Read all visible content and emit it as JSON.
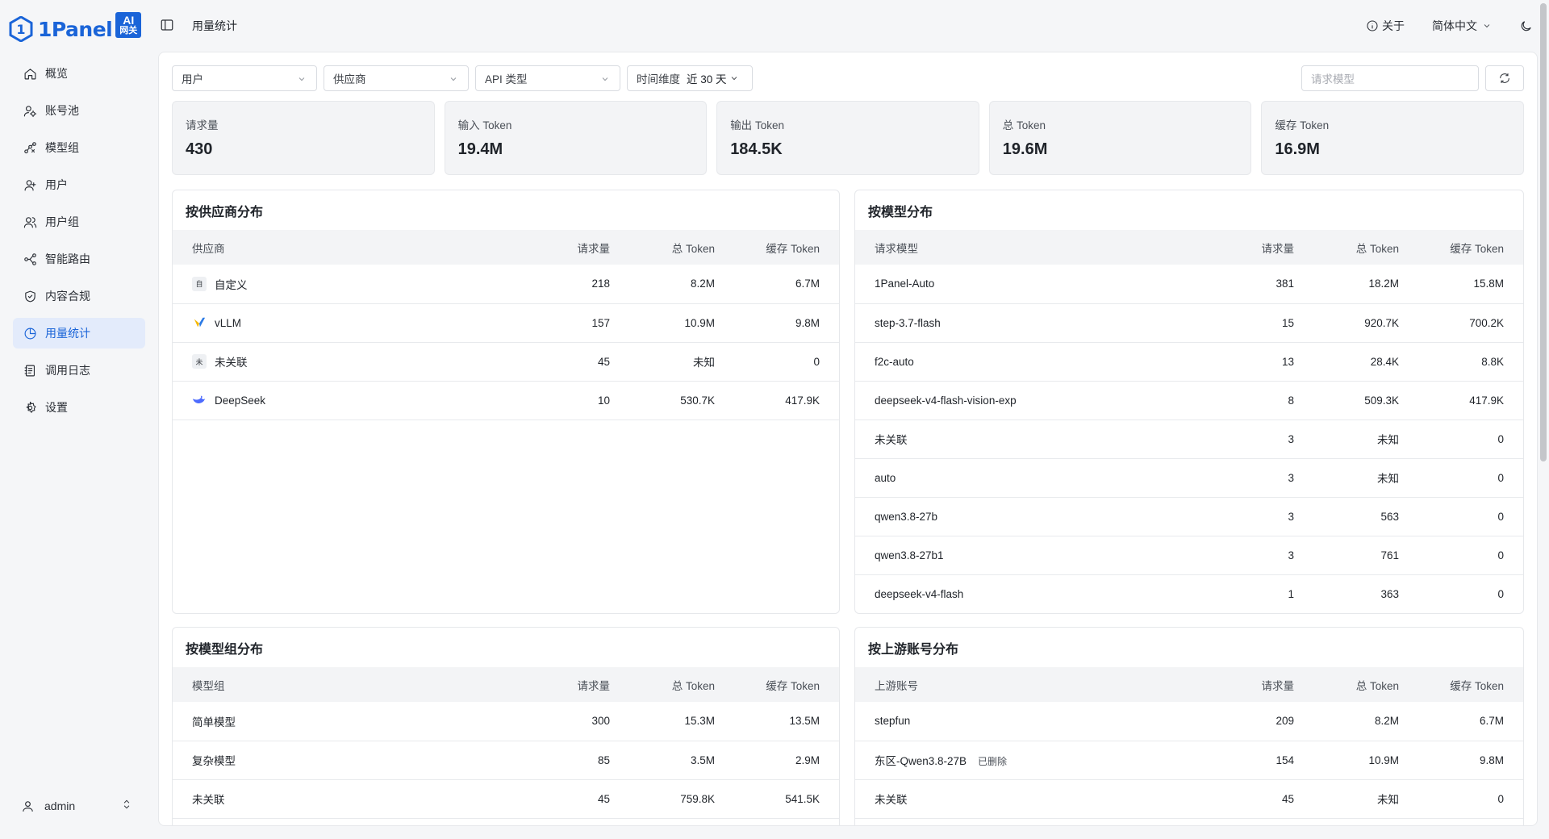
{
  "brand": {
    "name": "1Panel",
    "badge_line1": "AI",
    "badge_line2": "网关"
  },
  "sidebar": {
    "items": [
      {
        "label": "概览",
        "icon": "home-icon",
        "active": false
      },
      {
        "label": "账号池",
        "icon": "account-pool-icon",
        "active": false
      },
      {
        "label": "模型组",
        "icon": "model-group-icon",
        "active": false
      },
      {
        "label": "用户",
        "icon": "user-icon",
        "active": false
      },
      {
        "label": "用户组",
        "icon": "user-group-icon",
        "active": false
      },
      {
        "label": "智能路由",
        "icon": "route-icon",
        "active": false
      },
      {
        "label": "内容合规",
        "icon": "shield-icon",
        "active": false
      },
      {
        "label": "用量统计",
        "icon": "pie-chart-icon",
        "active": true
      },
      {
        "label": "调用日志",
        "icon": "log-icon",
        "active": false
      },
      {
        "label": "设置",
        "icon": "gear-icon",
        "active": false
      }
    ],
    "user": "admin"
  },
  "header": {
    "title": "用量统计",
    "about": "关于",
    "language": "简体中文"
  },
  "filters": {
    "user": "用户",
    "provider": "供应商",
    "api_type": "API 类型",
    "time_label": "时间维度",
    "time_value": "近 30 天",
    "search_placeholder": "请求模型"
  },
  "stats": [
    {
      "label": "请求量",
      "value": "430"
    },
    {
      "label": "输入 Token",
      "value": "19.4M"
    },
    {
      "label": "输出 Token",
      "value": "184.5K"
    },
    {
      "label": "总 Token",
      "value": "19.6M"
    },
    {
      "label": "缓存 Token",
      "value": "16.9M"
    }
  ],
  "by_provider": {
    "title": "按供应商分布",
    "headers": [
      "供应商",
      "请求量",
      "总 Token",
      "缓存 Token"
    ],
    "rows": [
      {
        "icon": "custom-icon",
        "icon_text": "自",
        "name": "自定义",
        "req": "218",
        "total": "8.2M",
        "cache": "6.7M"
      },
      {
        "icon": "vllm-icon",
        "icon_text": "",
        "name": "vLLM",
        "req": "157",
        "total": "10.9M",
        "cache": "9.8M"
      },
      {
        "icon": "unlinked-icon",
        "icon_text": "未",
        "name": "未关联",
        "req": "45",
        "total": "未知",
        "cache": "0"
      },
      {
        "icon": "deepseek-icon",
        "icon_text": "",
        "name": "DeepSeek",
        "req": "10",
        "total": "530.7K",
        "cache": "417.9K"
      }
    ]
  },
  "by_model": {
    "title": "按模型分布",
    "headers": [
      "请求模型",
      "请求量",
      "总 Token",
      "缓存 Token"
    ],
    "rows": [
      {
        "name": "1Panel-Auto",
        "req": "381",
        "total": "18.2M",
        "cache": "15.8M"
      },
      {
        "name": "step-3.7-flash",
        "req": "15",
        "total": "920.7K",
        "cache": "700.2K"
      },
      {
        "name": "f2c-auto",
        "req": "13",
        "total": "28.4K",
        "cache": "8.8K"
      },
      {
        "name": "deepseek-v4-flash-vision-exp",
        "req": "8",
        "total": "509.3K",
        "cache": "417.9K"
      },
      {
        "name": "未关联",
        "req": "3",
        "total": "未知",
        "cache": "0"
      },
      {
        "name": "auto",
        "req": "3",
        "total": "未知",
        "cache": "0"
      },
      {
        "name": "qwen3.8-27b",
        "req": "3",
        "total": "563",
        "cache": "0"
      },
      {
        "name": "qwen3.8-27b1",
        "req": "3",
        "total": "761",
        "cache": "0"
      },
      {
        "name": "deepseek-v4-flash",
        "req": "1",
        "total": "363",
        "cache": "0"
      }
    ]
  },
  "by_model_group": {
    "title": "按模型组分布",
    "headers": [
      "模型组",
      "请求量",
      "总 Token",
      "缓存 Token"
    ],
    "rows": [
      {
        "name": "简单模型",
        "req": "300",
        "total": "15.3M",
        "cache": "13.5M"
      },
      {
        "name": "复杂模型",
        "req": "85",
        "total": "3.5M",
        "cache": "2.9M"
      },
      {
        "name": "未关联",
        "req": "45",
        "total": "759.8K",
        "cache": "541.5K"
      }
    ]
  },
  "by_upstream": {
    "title": "按上游账号分布",
    "headers": [
      "上游账号",
      "请求量",
      "总 Token",
      "缓存 Token"
    ],
    "rows": [
      {
        "name": "stepfun",
        "tag": "",
        "req": "209",
        "total": "8.2M",
        "cache": "6.7M"
      },
      {
        "name": "东区-Qwen3.8-27B",
        "tag": "已删除",
        "req": "154",
        "total": "10.9M",
        "cache": "9.8M"
      },
      {
        "name": "未关联",
        "tag": "",
        "req": "45",
        "total": "未知",
        "cache": "0"
      }
    ]
  },
  "colors": {
    "accent": "#1a64d8",
    "active_bg": "#e3ebfb"
  }
}
